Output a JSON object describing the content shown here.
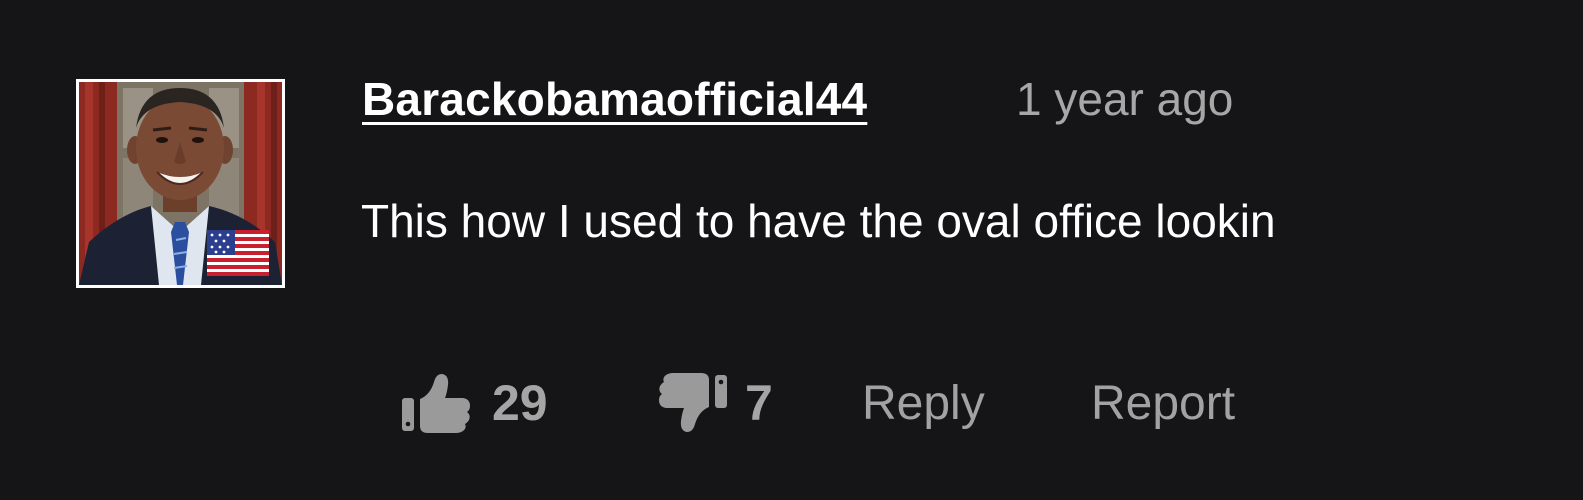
{
  "comment": {
    "username": "Barackobamaofficial44",
    "timestamp": "1 year ago",
    "text": "This how I used to have the oval office lookin",
    "likes": "29",
    "dislikes": "7",
    "reply_label": "Reply",
    "report_label": "Report",
    "avatar_icon": "user-avatar-photo",
    "like_icon": "thumbs-up-icon",
    "dislike_icon": "thumbs-down-icon"
  },
  "colors": {
    "background": "#151517",
    "username": "#ffffff",
    "timestamp": "#a7a7a7",
    "action": "#9a9a9a"
  }
}
